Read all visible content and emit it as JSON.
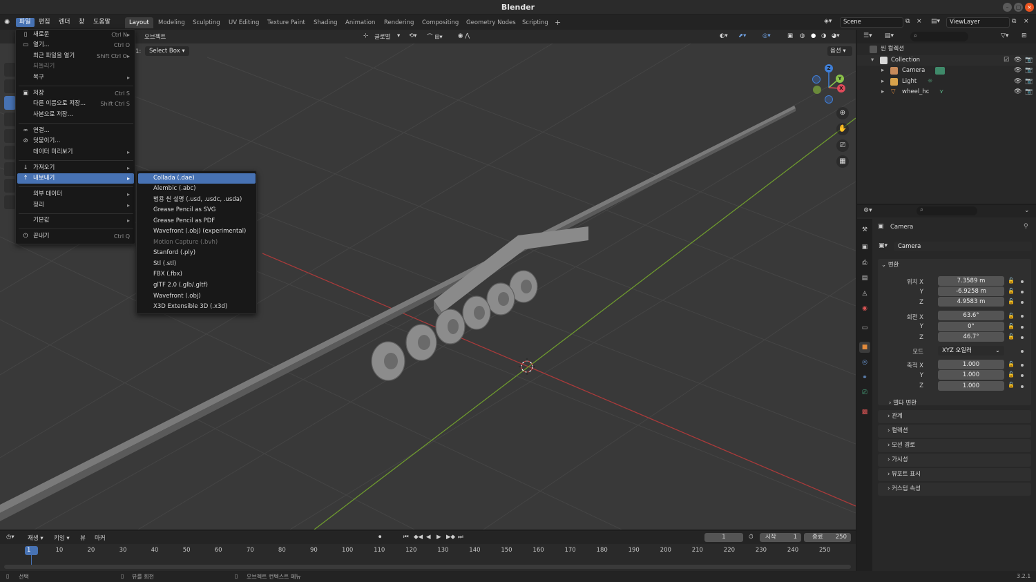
{
  "window": {
    "title": "Blender"
  },
  "topbar": {
    "menus": [
      "파일",
      "편집",
      "렌더",
      "창",
      "도움말"
    ],
    "workspaces": [
      "Layout",
      "Modeling",
      "Sculpting",
      "UV Editing",
      "Texture Paint",
      "Shading",
      "Animation",
      "Rendering",
      "Compositing",
      "Geometry Nodes",
      "Scripting"
    ],
    "add_tab": "+",
    "scene": "Scene",
    "view_layer": "ViewLayer"
  },
  "viewport_header": {
    "object_menu": "오브젝트",
    "select_mode_prefix": "1:",
    "select_mode": "Select Box",
    "orientation": "글로벌",
    "options": "옵션"
  },
  "file_menu": {
    "items": [
      {
        "label": "새로운",
        "shortcut": "Ctrl N",
        "icon": "new-file-icon",
        "glyph": "▯",
        "submenu": true
      },
      {
        "label": "열기...",
        "shortcut": "Ctrl O",
        "icon": "folder-icon",
        "glyph": "▭"
      },
      {
        "label": "최근 파일을 열기",
        "shortcut": "Shift Ctrl O",
        "submenu": true
      },
      {
        "label": "되돌리기",
        "disabled": true
      },
      {
        "label": "복구",
        "submenu": true
      },
      {
        "label": "저장",
        "shortcut": "Ctrl S",
        "icon": "save-icon",
        "glyph": "▣"
      },
      {
        "label": "다른 이름으로 저장...",
        "shortcut": "Shift Ctrl S"
      },
      {
        "label": "사본으로 저장..."
      },
      {
        "label": "연결...",
        "icon": "link-icon",
        "glyph": "∞"
      },
      {
        "label": "덧붙이기...",
        "icon": "append-icon",
        "glyph": "⊘"
      },
      {
        "label": "데이터 미리보기",
        "submenu": true
      },
      {
        "label": "가져오기",
        "icon": "import-icon",
        "glyph": "↓",
        "submenu": true
      },
      {
        "label": "내보내기",
        "icon": "export-icon",
        "glyph": "↑",
        "submenu": true,
        "highlighted": true
      },
      {
        "label": "외부 데이터",
        "submenu": true
      },
      {
        "label": "정리",
        "submenu": true
      },
      {
        "label": "기본값",
        "submenu": true
      },
      {
        "label": "끝내기",
        "shortcut": "Ctrl Q",
        "icon": "quit-icon",
        "glyph": "⏻"
      }
    ]
  },
  "export_menu": {
    "items": [
      {
        "label": "Collada (.dae)",
        "highlighted": true
      },
      {
        "label": "Alembic (.abc)"
      },
      {
        "label": "범용 씬 설명 (.usd, .usdc, .usda)"
      },
      {
        "label": "Grease Pencil as SVG"
      },
      {
        "label": "Grease Pencil as PDF"
      },
      {
        "label": "Wavefront (.obj) (experimental)"
      },
      {
        "label": "Motion Capture (.bvh)",
        "disabled": true
      },
      {
        "label": "Stanford (.ply)"
      },
      {
        "label": "Stl (.stl)"
      },
      {
        "label": "FBX (.fbx)"
      },
      {
        "label": "glTF 2.0 (.glb/.gltf)"
      },
      {
        "label": "Wavefront (.obj)"
      },
      {
        "label": "X3D Extensible 3D (.x3d)"
      }
    ]
  },
  "gizmo": {
    "x": "X",
    "y": "Y",
    "z": "Z"
  },
  "outliner": {
    "scene_collection": "씬 컬렉션",
    "collection": "Collection",
    "objects": [
      {
        "name": "Camera",
        "color": "#c78a5a"
      },
      {
        "name": "Light",
        "color": "#d8a24b"
      },
      {
        "name": "wheel_hc",
        "color": "#e38b3c"
      }
    ]
  },
  "properties": {
    "header_object": "Camera",
    "object_name": "Camera",
    "transform_panel": "변환",
    "location": {
      "label": "위치 X",
      "y_label": "Y",
      "z_label": "Z",
      "x": "7.3589 m",
      "y": "-6.9258 m",
      "z": "4.9583 m"
    },
    "rotation": {
      "label": "회전 X",
      "y_label": "Y",
      "z_label": "Z",
      "x": "63.6°",
      "y": "0°",
      "z": "46.7°"
    },
    "mode": {
      "label": "모드",
      "value": "XYZ 오일러"
    },
    "scale": {
      "label": "축적 X",
      "y_label": "Y",
      "z_label": "Z",
      "x": "1.000",
      "y": "1.000",
      "z": "1.000"
    },
    "delta_transform": "델타 변환",
    "panels": [
      "관계",
      "컬렉션",
      "모션 경로",
      "가시성",
      "뷰포트 표시",
      "커스텀 속성"
    ]
  },
  "timeline": {
    "menus": [
      "재생",
      "키잉",
      "뷰",
      "마커"
    ],
    "current_frame": "1",
    "start_label": "시작",
    "start": "1",
    "end_label": "종료",
    "end": "250",
    "ticks": [
      "1",
      "10",
      "20",
      "30",
      "40",
      "50",
      "60",
      "70",
      "80",
      "90",
      "100",
      "110",
      "120",
      "130",
      "140",
      "150",
      "160",
      "170",
      "180",
      "190",
      "200",
      "210",
      "220",
      "230",
      "240",
      "250"
    ]
  },
  "statusbar": {
    "select": "선택",
    "rotate_view": "뷰를 회전",
    "context_menu": "오브젝트 컨텍스트 메뉴",
    "version": "3.2.1"
  }
}
